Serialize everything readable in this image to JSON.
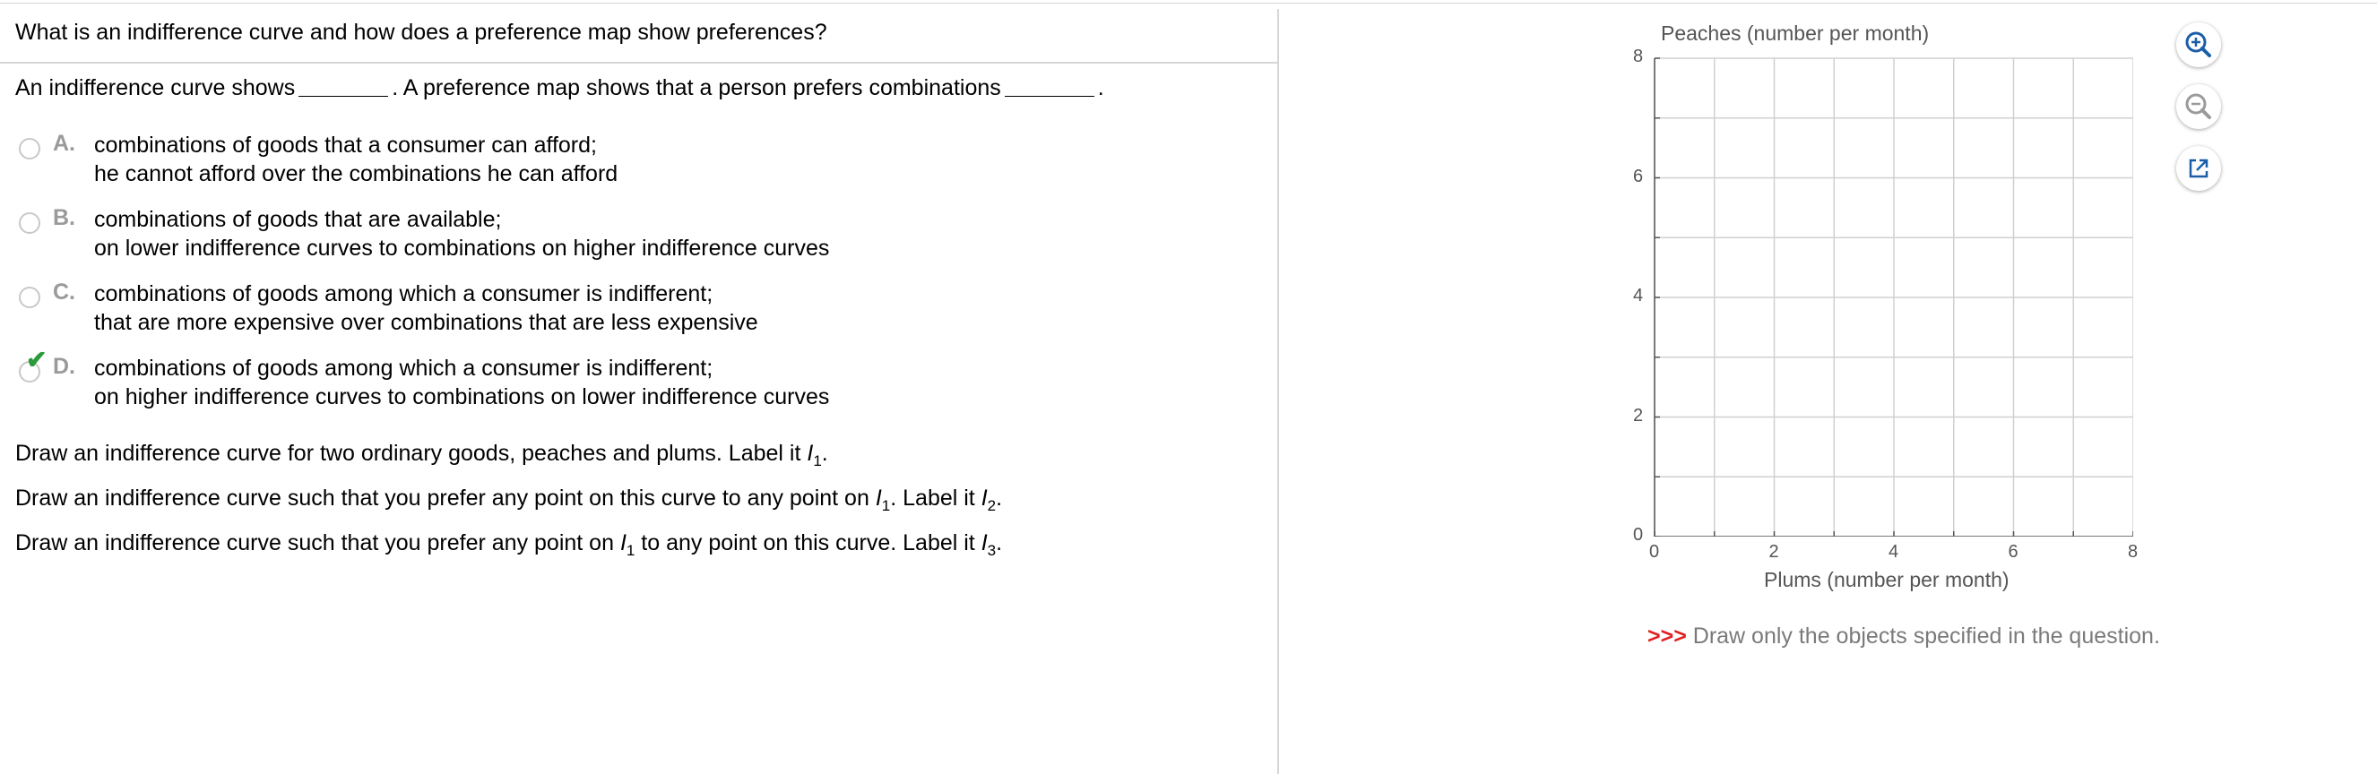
{
  "question": {
    "title": "What is an indifference curve and how does a preference map show preferences?",
    "stem_part1": "An indifference curve shows",
    "stem_part2": ". A preference map shows that a person prefers combinations",
    "stem_end": "."
  },
  "options": [
    {
      "letter": "A.",
      "line1": "combinations of goods that a consumer can afford;",
      "line2": "he cannot afford over the combinations he can afford",
      "selected": false
    },
    {
      "letter": "B.",
      "line1": "combinations of goods that are available;",
      "line2": "on lower indifference curves to combinations on higher indifference curves",
      "selected": false
    },
    {
      "letter": "C.",
      "line1": "combinations of goods among which a consumer is indifferent;",
      "line2": "that are more expensive over combinations that are less expensive",
      "selected": false
    },
    {
      "letter": "D.",
      "line1": "combinations of goods among which a consumer is indifferent;",
      "line2": "on higher indifference curves to combinations on lower indifference curves",
      "selected": true
    }
  ],
  "instructions": {
    "i1_a": "Draw an indifference curve for two ordinary goods, peaches and plums. Label it ",
    "i1_var": "I",
    "i1_sub": "1",
    "i1_end": ".",
    "i2_a": "Draw an indifference curve such that you prefer any point on this curve to any point on ",
    "i2_var1": "I",
    "i2_sub1": "1",
    "i2_mid": ". Label it ",
    "i2_var2": "I",
    "i2_sub2": "2",
    "i2_end": ".",
    "i3_a": "Draw an indifference curve such that you prefer any point on ",
    "i3_var1": "I",
    "i3_sub1": "1",
    "i3_mid": " to any point on this curve. Label it ",
    "i3_var2": "I",
    "i3_sub2": "3",
    "i3_end": "."
  },
  "graph": {
    "y_label": "Peaches (number per month)",
    "x_label": "Plums (number per month)",
    "x_ticks": [
      "0",
      "2",
      "4",
      "6",
      "8"
    ],
    "y_ticks": [
      "0",
      "2",
      "4",
      "6",
      "8"
    ],
    "x_range": [
      0,
      8
    ],
    "y_range": [
      0,
      8
    ],
    "grid": true,
    "grid_step": 1
  },
  "tools": {
    "zoom_in_icon": "zoom-in-icon",
    "zoom_out_icon": "zoom-out-icon",
    "expand_icon": "open-external-icon"
  },
  "note": {
    "arrows": ">>>",
    "text": " Draw only the objects specified in the question."
  },
  "colors": {
    "check": "#2a9a3a",
    "note_arrows": "#e02020",
    "zoom_in": "#1a5ea8"
  }
}
